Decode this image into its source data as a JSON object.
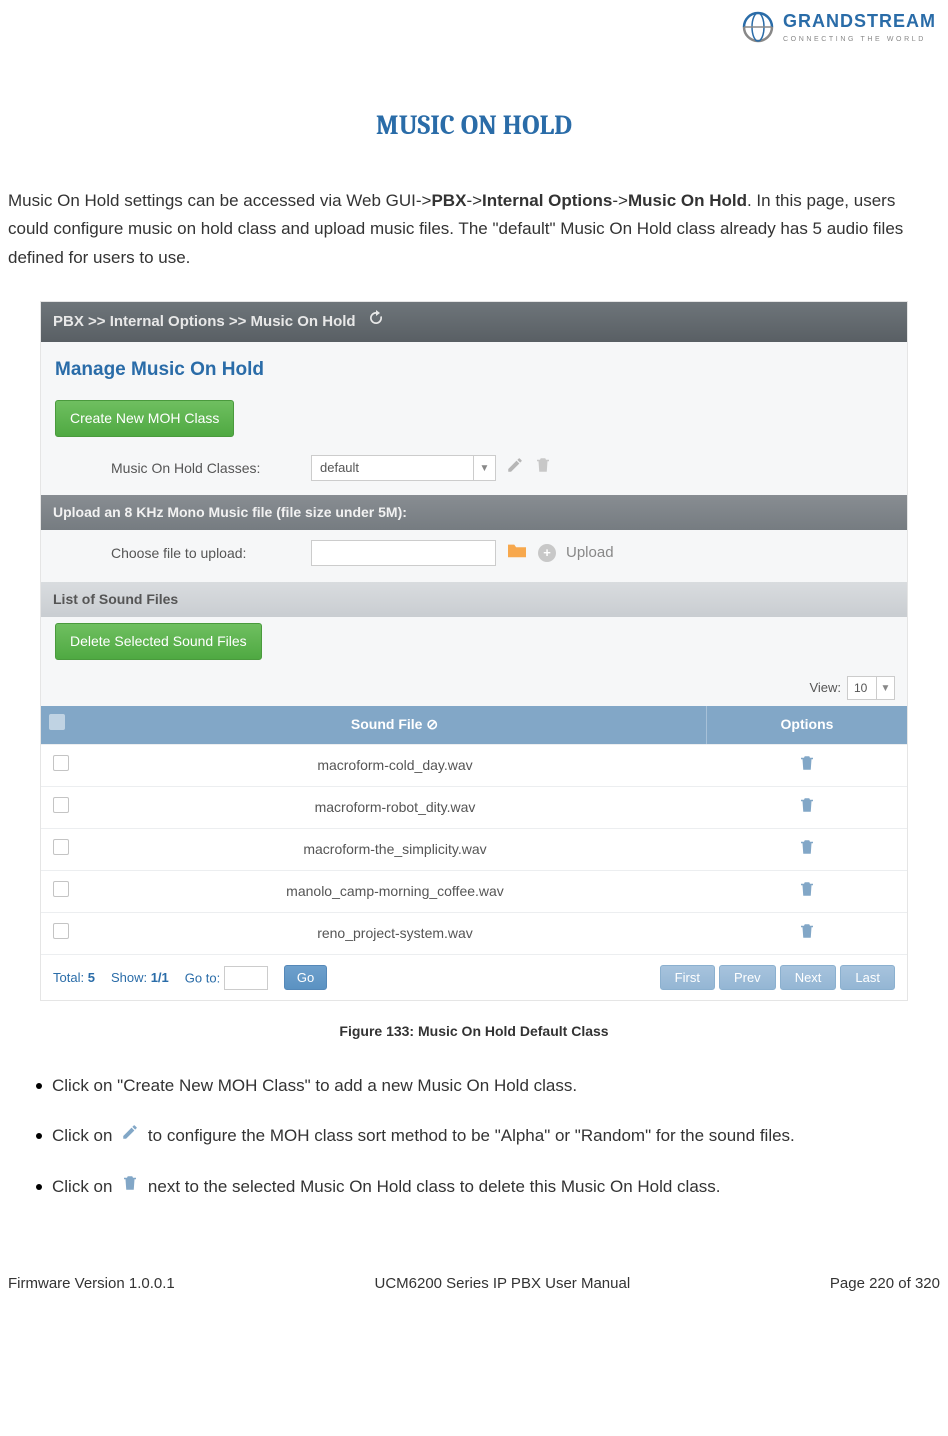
{
  "logo": {
    "brand": "GRANDSTREAM",
    "tagline": "CONNECTING THE WORLD"
  },
  "title": "MUSIC ON HOLD",
  "intro": {
    "p1a": "Music On Hold settings can be accessed via Web GUI->",
    "b1": "PBX",
    "sep": "->",
    "b2": "Internal Options",
    "b3": "Music On Hold",
    "p1b": ". In this page, users could configure music on hold class and upload music files. The \"default\" Music On Hold class already has 5 audio files defined for users to use."
  },
  "screenshot": {
    "breadcrumb": "PBX >> Internal Options >> Music On Hold",
    "panel_title": "Manage Music On Hold",
    "create_btn": "Create New MOH Class",
    "classes_label": "Music On Hold Classes:",
    "classes_value": "default",
    "upload_section": "Upload an 8 KHz Mono Music file (file size under 5M):",
    "choose_label": "Choose file to upload:",
    "upload_text": "Upload",
    "list_section": "List of Sound Files",
    "delete_btn": "Delete Selected Sound Files",
    "view_label": "View:",
    "view_value": "10",
    "th_sound": "Sound File",
    "th_options": "Options",
    "rows": [
      "macroform-cold_day.wav",
      "macroform-robot_dity.wav",
      "macroform-the_simplicity.wav",
      "manolo_camp-morning_coffee.wav",
      "reno_project-system.wav"
    ],
    "total_label": "Total:",
    "total_val": "5",
    "show_label": "Show:",
    "show_val": "1/1",
    "goto_label": "Go to:",
    "go_btn": "Go",
    "pager": [
      "First",
      "Prev",
      "Next",
      "Last"
    ]
  },
  "caption": "Figure 133: Music On Hold Default Class",
  "bullets": {
    "b1": "Click on \"Create New MOH Class\" to add a new Music On Hold class.",
    "b2a": "Click on ",
    "b2b": " to configure the MOH class sort method to be \"Alpha\" or \"Random\" for the sound files.",
    "b3a": "Click on ",
    "b3b": " next to the selected Music On Hold class to delete this Music On Hold class."
  },
  "footer": {
    "left": "Firmware Version 1.0.0.1",
    "center": "UCM6200 Series IP PBX User Manual",
    "right": "Page 220 of 320"
  }
}
